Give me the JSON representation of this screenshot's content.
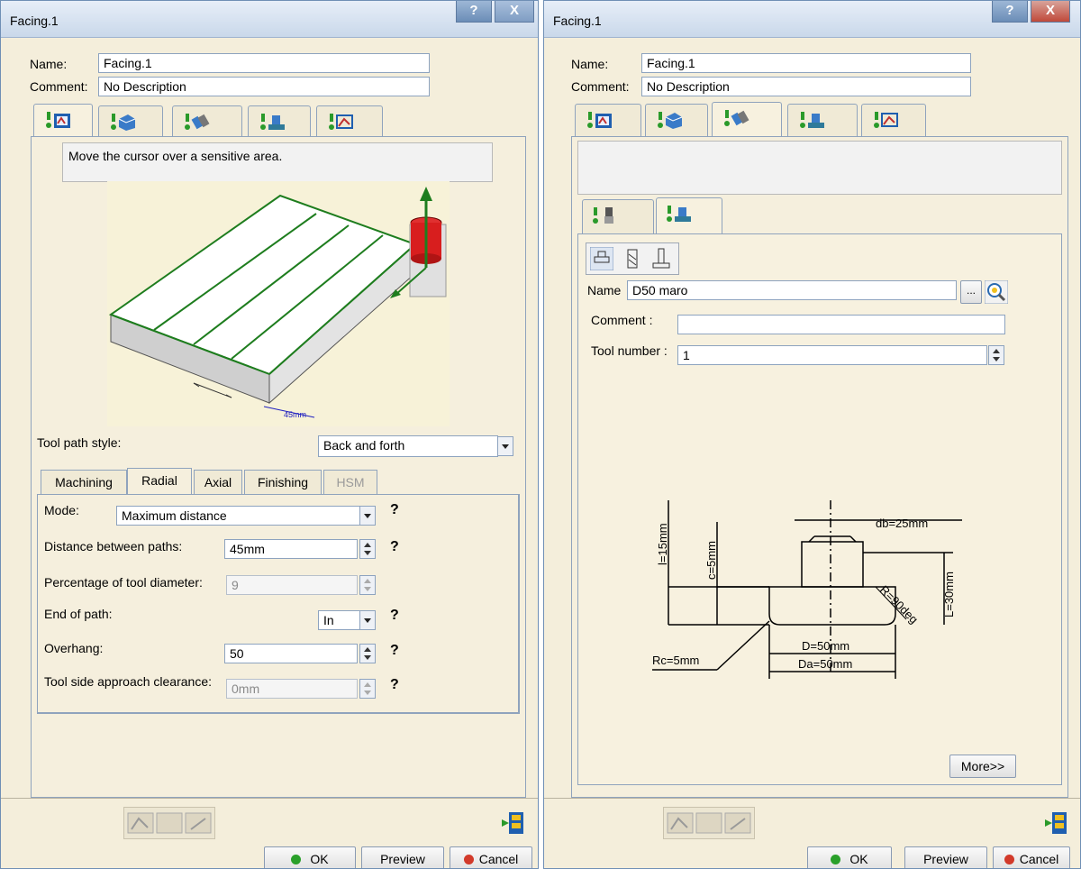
{
  "left_window": {
    "title": "Facing.1",
    "help_button": "?",
    "close_button": "X",
    "name_label": "Name:",
    "name_value": "Facing.1",
    "comment_label": "Comment:",
    "comment_value": "No Description",
    "hint_text": "Move the cursor over a sensitive area.",
    "diagram_dimension": "45mm",
    "tool_path_style_label": "Tool path style:",
    "tool_path_style_value": "Back and forth",
    "tabs": [
      "Machining",
      "Radial",
      "Axial",
      "Finishing",
      "HSM"
    ],
    "active_tab": "Radial",
    "params": {
      "mode_label": "Mode:",
      "mode_value": "Maximum distance",
      "distance_label": "Distance between paths:",
      "distance_value": "45mm",
      "percentage_label": "Percentage of tool diameter:",
      "percentage_value": "9",
      "end_label": "End of path:",
      "end_value": "In",
      "overhang_label": "Overhang:",
      "overhang_value": "50",
      "clearance_label": "Tool side approach clearance:",
      "clearance_value": "0mm",
      "help": "?"
    },
    "ok_label": "OK",
    "preview_label": "Preview",
    "cancel_label": "Cancel"
  },
  "right_window": {
    "title": "Facing.1",
    "help_button": "?",
    "close_button": "X",
    "name_label": "Name:",
    "name_value": "Facing.1",
    "comment_label": "Comment:",
    "comment_value": "No Description",
    "tool_name_label": "Name",
    "tool_name_value": "D50 maro",
    "browse_label": "...",
    "tool_comment_label": "Comment :",
    "tool_comment_value": "",
    "tool_number_label": "Tool number :",
    "tool_number_value": "1",
    "drawing_labels": {
      "db": "db=25mm",
      "l": "l=15mm",
      "lc": "c=5mm",
      "L": "L=30mm",
      "r": "R=90deg",
      "rc": "Rc=5mm",
      "d": "D=50mm",
      "da": "Da=50mm"
    },
    "more_label": "More>>",
    "ok_label": "OK",
    "preview_label": "Preview",
    "cancel_label": "Cancel"
  },
  "colors": {
    "dialog_bg": "#f4eedb",
    "title_bar": "#c9d8ea",
    "ok_green": "#2aa02a",
    "cancel_red": "#d23a2a",
    "diagram_green": "#1e7d1e",
    "dimension_blue": "#2020c0"
  }
}
